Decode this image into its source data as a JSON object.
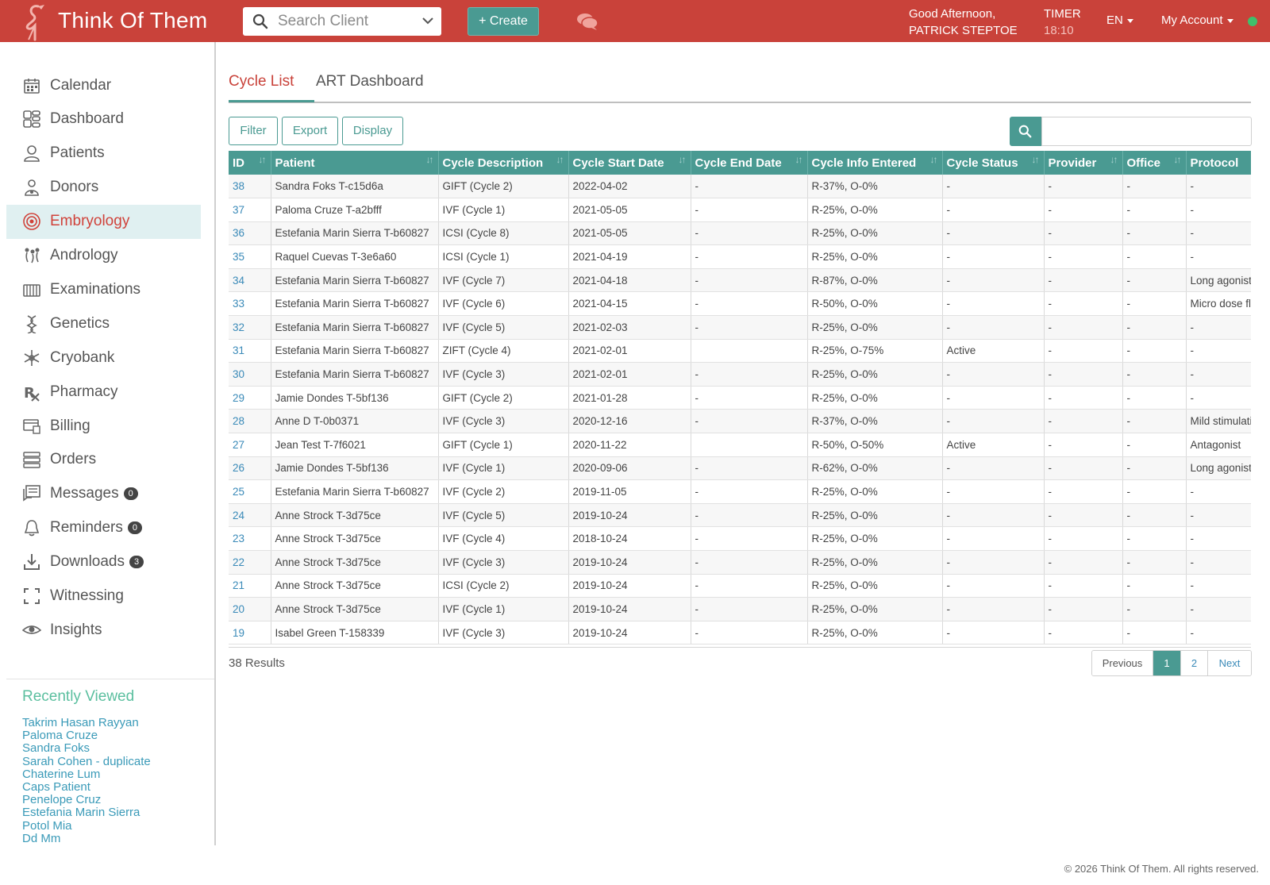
{
  "header": {
    "brand": "Think Of Them",
    "search_placeholder": "Search Client",
    "create_label": "+ Create",
    "greeting_line1": "Good Afternoon,",
    "greeting_line2": "PATRICK STEPTOE",
    "timer_label": "TIMER",
    "timer_value": "18:10",
    "language": "EN",
    "account_label": "My Account",
    "brand_color": "#c9423a",
    "accent_color": "#4a9a92"
  },
  "sidebar": {
    "items": [
      {
        "label": "Calendar",
        "icon": "calendar-icon"
      },
      {
        "label": "Dashboard",
        "icon": "dashboard-icon"
      },
      {
        "label": "Patients",
        "icon": "person-icon"
      },
      {
        "label": "Donors",
        "icon": "donor-icon"
      },
      {
        "label": "Embryology",
        "icon": "embryo-icon",
        "active": true
      },
      {
        "label": "Andrology",
        "icon": "andrology-icon"
      },
      {
        "label": "Examinations",
        "icon": "examinations-icon"
      },
      {
        "label": "Genetics",
        "icon": "dna-icon"
      },
      {
        "label": "Cryobank",
        "icon": "snowflake-icon"
      },
      {
        "label": "Pharmacy",
        "icon": "rx-icon"
      },
      {
        "label": "Billing",
        "icon": "billing-icon"
      },
      {
        "label": "Orders",
        "icon": "orders-icon"
      },
      {
        "label": "Messages",
        "icon": "messages-icon",
        "badge": "0"
      },
      {
        "label": "Reminders",
        "icon": "bell-icon",
        "badge": "0"
      },
      {
        "label": "Downloads",
        "icon": "download-icon",
        "badge": "3"
      },
      {
        "label": "Witnessing",
        "icon": "witnessing-icon"
      },
      {
        "label": "Insights",
        "icon": "eye-icon"
      }
    ],
    "recent_title": "Recently Viewed",
    "recent": [
      "Takrim Hasan Rayyan",
      "Paloma Cruze",
      "Sandra Foks",
      "Sarah Cohen - duplicate",
      "Chaterine Lum",
      "Caps Patient",
      "Penelope Cruz",
      "Estefania Marin Sierra",
      "Potol Mia",
      "Dd Mm"
    ]
  },
  "main": {
    "tabs": [
      "Cycle List",
      "ART Dashboard"
    ],
    "toolbar": {
      "filter": "Filter",
      "export": "Export",
      "display": "Display"
    },
    "columns": [
      "ID",
      "Patient",
      "Cycle Description",
      "Cycle Start Date",
      "Cycle End Date",
      "Cycle Info Entered",
      "Cycle Status",
      "Provider",
      "Office",
      "Protocol"
    ],
    "rows": [
      [
        "38",
        "Sandra Foks T-c15d6a",
        "GIFT (Cycle 2)",
        "2022-04-02",
        "-",
        "R-37%, O-0%",
        "-",
        "-",
        "-",
        "-"
      ],
      [
        "37",
        "Paloma Cruze T-a2bfff",
        "IVF (Cycle 1)",
        "2021-05-05",
        "-",
        "R-25%, O-0%",
        "-",
        "-",
        "-",
        "-"
      ],
      [
        "36",
        "Estefania Marin Sierra T-b60827",
        "ICSI (Cycle 8)",
        "2021-05-05",
        "-",
        "R-25%, O-0%",
        "-",
        "-",
        "-",
        "-"
      ],
      [
        "35",
        "Raquel Cuevas T-3e6a60",
        "ICSI (Cycle 1)",
        "2021-04-19",
        "-",
        "R-25%, O-0%",
        "-",
        "-",
        "-",
        "-"
      ],
      [
        "34",
        "Estefania Marin Sierra T-b60827",
        "IVF (Cycle 7)",
        "2021-04-18",
        "-",
        "R-87%, O-0%",
        "-",
        "-",
        "-",
        "Long agonist"
      ],
      [
        "33",
        "Estefania Marin Sierra T-b60827",
        "IVF (Cycle 6)",
        "2021-04-15",
        "-",
        "R-50%, O-0%",
        "-",
        "-",
        "-",
        "Micro dose flare"
      ],
      [
        "32",
        "Estefania Marin Sierra T-b60827",
        "IVF (Cycle 5)",
        "2021-02-03",
        "-",
        "R-25%, O-0%",
        "-",
        "-",
        "-",
        "-"
      ],
      [
        "31",
        "Estefania Marin Sierra T-b60827",
        "ZIFT (Cycle 4)",
        "2021-02-01",
        "",
        "R-25%, O-75%",
        "Active",
        "-",
        "-",
        "-"
      ],
      [
        "30",
        "Estefania Marin Sierra T-b60827",
        "IVF (Cycle 3)",
        "2021-02-01",
        "-",
        "R-25%, O-0%",
        "-",
        "-",
        "-",
        "-"
      ],
      [
        "29",
        "Jamie Dondes T-5bf136",
        "GIFT (Cycle 2)",
        "2021-01-28",
        "-",
        "R-25%, O-0%",
        "-",
        "-",
        "-",
        "-"
      ],
      [
        "28",
        "Anne D T-0b0371",
        "IVF (Cycle 3)",
        "2020-12-16",
        "-",
        "R-37%, O-0%",
        "-",
        "-",
        "-",
        "Mild stimulation"
      ],
      [
        "27",
        "Jean Test T-7f6021",
        "GIFT (Cycle 1)",
        "2020-11-22",
        "",
        "R-50%, O-50%",
        "Active",
        "-",
        "-",
        "Antagonist"
      ],
      [
        "26",
        "Jamie Dondes T-5bf136",
        "IVF (Cycle 1)",
        "2020-09-06",
        "-",
        "R-62%, O-0%",
        "-",
        "-",
        "-",
        "Long agonist"
      ],
      [
        "25",
        "Estefania Marin Sierra T-b60827",
        "IVF (Cycle 2)",
        "2019-11-05",
        "-",
        "R-25%, O-0%",
        "-",
        "-",
        "-",
        "-"
      ],
      [
        "24",
        "Anne Strock T-3d75ce",
        "IVF (Cycle 5)",
        "2019-10-24",
        "-",
        "R-25%, O-0%",
        "-",
        "-",
        "-",
        "-"
      ],
      [
        "23",
        "Anne Strock T-3d75ce",
        "IVF (Cycle 4)",
        "2018-10-24",
        "-",
        "R-25%, O-0%",
        "-",
        "-",
        "-",
        "-"
      ],
      [
        "22",
        "Anne Strock T-3d75ce",
        "IVF (Cycle 3)",
        "2019-10-24",
        "-",
        "R-25%, O-0%",
        "-",
        "-",
        "-",
        "-"
      ],
      [
        "21",
        "Anne Strock T-3d75ce",
        "ICSI (Cycle 2)",
        "2019-10-24",
        "-",
        "R-25%, O-0%",
        "-",
        "-",
        "-",
        "-"
      ],
      [
        "20",
        "Anne Strock T-3d75ce",
        "IVF (Cycle 1)",
        "2019-10-24",
        "-",
        "R-25%, O-0%",
        "-",
        "-",
        "-",
        "-"
      ],
      [
        "19",
        "Isabel Green T-158339",
        "IVF (Cycle 3)",
        "2019-10-24",
        "-",
        "R-25%, O-0%",
        "-",
        "-",
        "-",
        "-"
      ]
    ],
    "results_text": "38 Results",
    "pagination": {
      "previous": "Previous",
      "pages": [
        "1",
        "2"
      ],
      "current": "1",
      "next": "Next"
    }
  },
  "footer": "© 2026 Think Of Them. All rights reserved."
}
